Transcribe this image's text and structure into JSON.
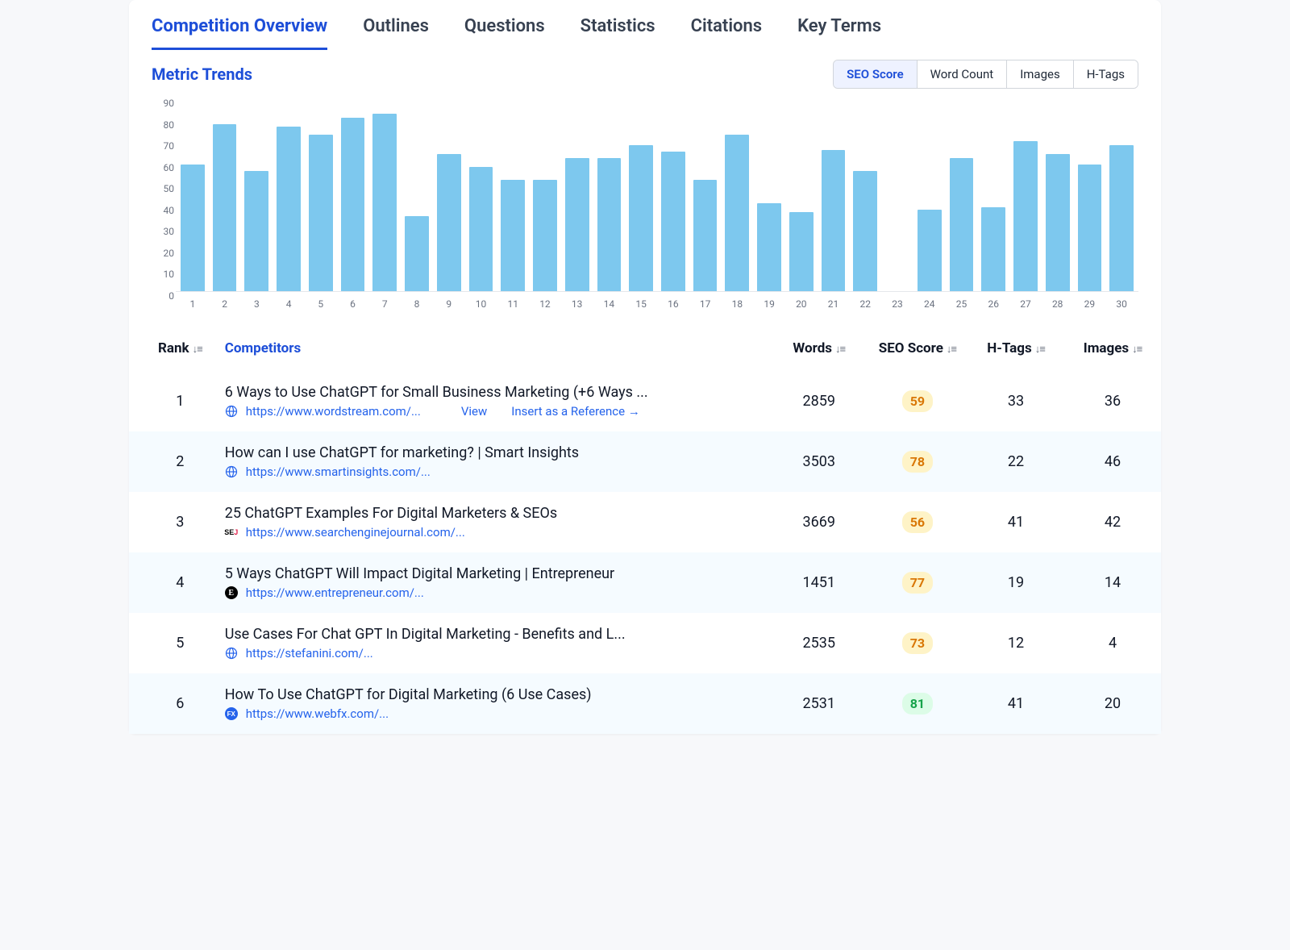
{
  "tabs": [
    "Competition Overview",
    "Outlines",
    "Questions",
    "Statistics",
    "Citations",
    "Key Terms"
  ],
  "active_tab": 0,
  "section_title": "Metric Trends",
  "metrics": [
    "SEO Score",
    "Word Count",
    "Images",
    "H-Tags"
  ],
  "active_metric": 0,
  "chart_data": {
    "type": "bar",
    "title": "",
    "xlabel": "",
    "ylabel": "",
    "ylim": [
      0,
      90
    ],
    "yticks": [
      0,
      10,
      20,
      30,
      40,
      50,
      60,
      70,
      80,
      90
    ],
    "categories": [
      "1",
      "2",
      "3",
      "4",
      "5",
      "6",
      "7",
      "8",
      "9",
      "10",
      "11",
      "12",
      "13",
      "14",
      "15",
      "16",
      "17",
      "18",
      "19",
      "20",
      "21",
      "22",
      "23",
      "24",
      "25",
      "26",
      "27",
      "28",
      "29",
      "30"
    ],
    "values": [
      59,
      78,
      56,
      77,
      73,
      81,
      83,
      35,
      64,
      58,
      52,
      52,
      62,
      62,
      68,
      65,
      52,
      73,
      41,
      37,
      66,
      56,
      null,
      38,
      62,
      39,
      70,
      64,
      59,
      68
    ]
  },
  "columns": {
    "rank": "Rank",
    "competitors": "Competitors",
    "words": "Words",
    "seo": "SEO Score",
    "htags": "H-Tags",
    "images": "Images"
  },
  "row_actions": {
    "view": "View",
    "insert": "Insert as a Reference →"
  },
  "sort_glyph": "↓≡",
  "rows": [
    {
      "rank": 1,
      "title": "6 Ways to Use ChatGPT for Small Business Marketing (+6 Ways ...",
      "url": "https://www.wordstream.com/...",
      "favicon": "globe",
      "words": 2859,
      "seo": 59,
      "seo_class": "yellow",
      "htags": 33,
      "images": 36,
      "show_actions": true
    },
    {
      "rank": 2,
      "title": "How can I use ChatGPT for marketing? | Smart Insights",
      "url": "https://www.smartinsights.com/...",
      "favicon": "globe",
      "words": 3503,
      "seo": 78,
      "seo_class": "yellow",
      "htags": 22,
      "images": 46
    },
    {
      "rank": 3,
      "title": "25 ChatGPT Examples For Digital Marketers & SEOs",
      "url": "https://www.searchenginejournal.com/...",
      "favicon": "sej",
      "words": 3669,
      "seo": 56,
      "seo_class": "yellow",
      "htags": 41,
      "images": 42
    },
    {
      "rank": 4,
      "title": "5 Ways ChatGPT Will Impact Digital Marketing | Entrepreneur",
      "url": "https://www.entrepreneur.com/...",
      "favicon": "e",
      "words": 1451,
      "seo": 77,
      "seo_class": "yellow",
      "htags": 19,
      "images": 14
    },
    {
      "rank": 5,
      "title": "Use Cases For Chat GPT In Digital Marketing - Benefits and L...",
      "url": "https://stefanini.com/...",
      "favicon": "globe",
      "words": 2535,
      "seo": 73,
      "seo_class": "yellow",
      "htags": 12,
      "images": 4
    },
    {
      "rank": 6,
      "title": "How To Use ChatGPT for Digital Marketing (6 Use Cases)",
      "url": "https://www.webfx.com/...",
      "favicon": "fx",
      "words": 2531,
      "seo": 81,
      "seo_class": "green",
      "htags": 41,
      "images": 20
    }
  ]
}
